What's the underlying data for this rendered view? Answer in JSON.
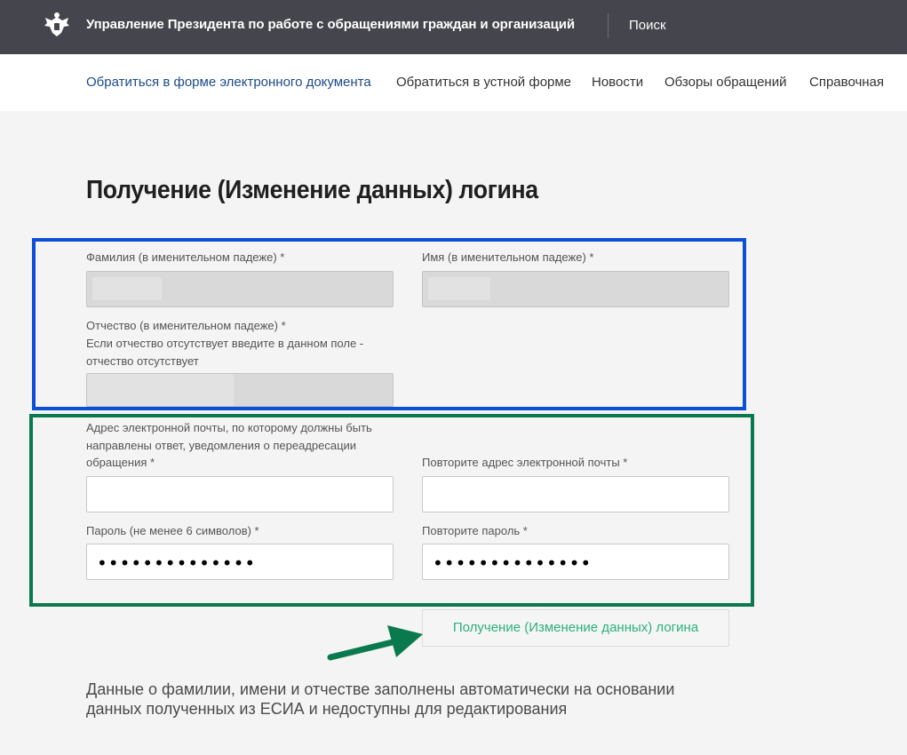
{
  "header": {
    "org_title": "Управление Президента по работе с обращениями граждан и организаций",
    "search_label": "Поиск",
    "bg_color": "#45454d"
  },
  "nav": {
    "items": [
      {
        "label": "Обратиться в форме электронного документа",
        "active": true
      },
      {
        "label": "Обратиться в устной форме",
        "active": false
      },
      {
        "label": "Новости",
        "active": false
      },
      {
        "label": "Обзоры обращений",
        "active": false
      },
      {
        "label": "Справочная",
        "active": false
      }
    ]
  },
  "page": {
    "title": "Получение (Изменение данных) логина"
  },
  "form": {
    "last_name_label": "Фамилия (в именительном падеже) *",
    "first_name_label": "Имя (в именительном падеже) *",
    "patronymic_label_1": "Отчество (в именительном падеже) *",
    "patronymic_label_2": "Если отчество отсутствует введите в данном поле -",
    "patronymic_label_3": "отчество отсутствует",
    "email_label_1": "Адрес электронной почты, по которому должны быть",
    "email_label_2": "направлены ответ, уведомления о переадресации",
    "email_label_3": "обращения *",
    "email_repeat_label": "Повторите адрес электронной почты *",
    "password_label": "Пароль (не менее 6 символов) *",
    "password_repeat_label": "Повторите пароль *",
    "password_value": "••••••••••••••",
    "password_repeat_value": "••••••••••••••",
    "submit_label": "Получение (Изменение данных) логина"
  },
  "note": {
    "text": "Данные о фамилии, имени и отчестве заполнены автоматически на основании данных полученных из ЕСИА и недоступны для редактирования"
  },
  "annotations": {
    "blue_box_color": "#0b4fd6",
    "green_box_color": "#0a7a4e",
    "arrow_color": "#0a7a4e"
  }
}
